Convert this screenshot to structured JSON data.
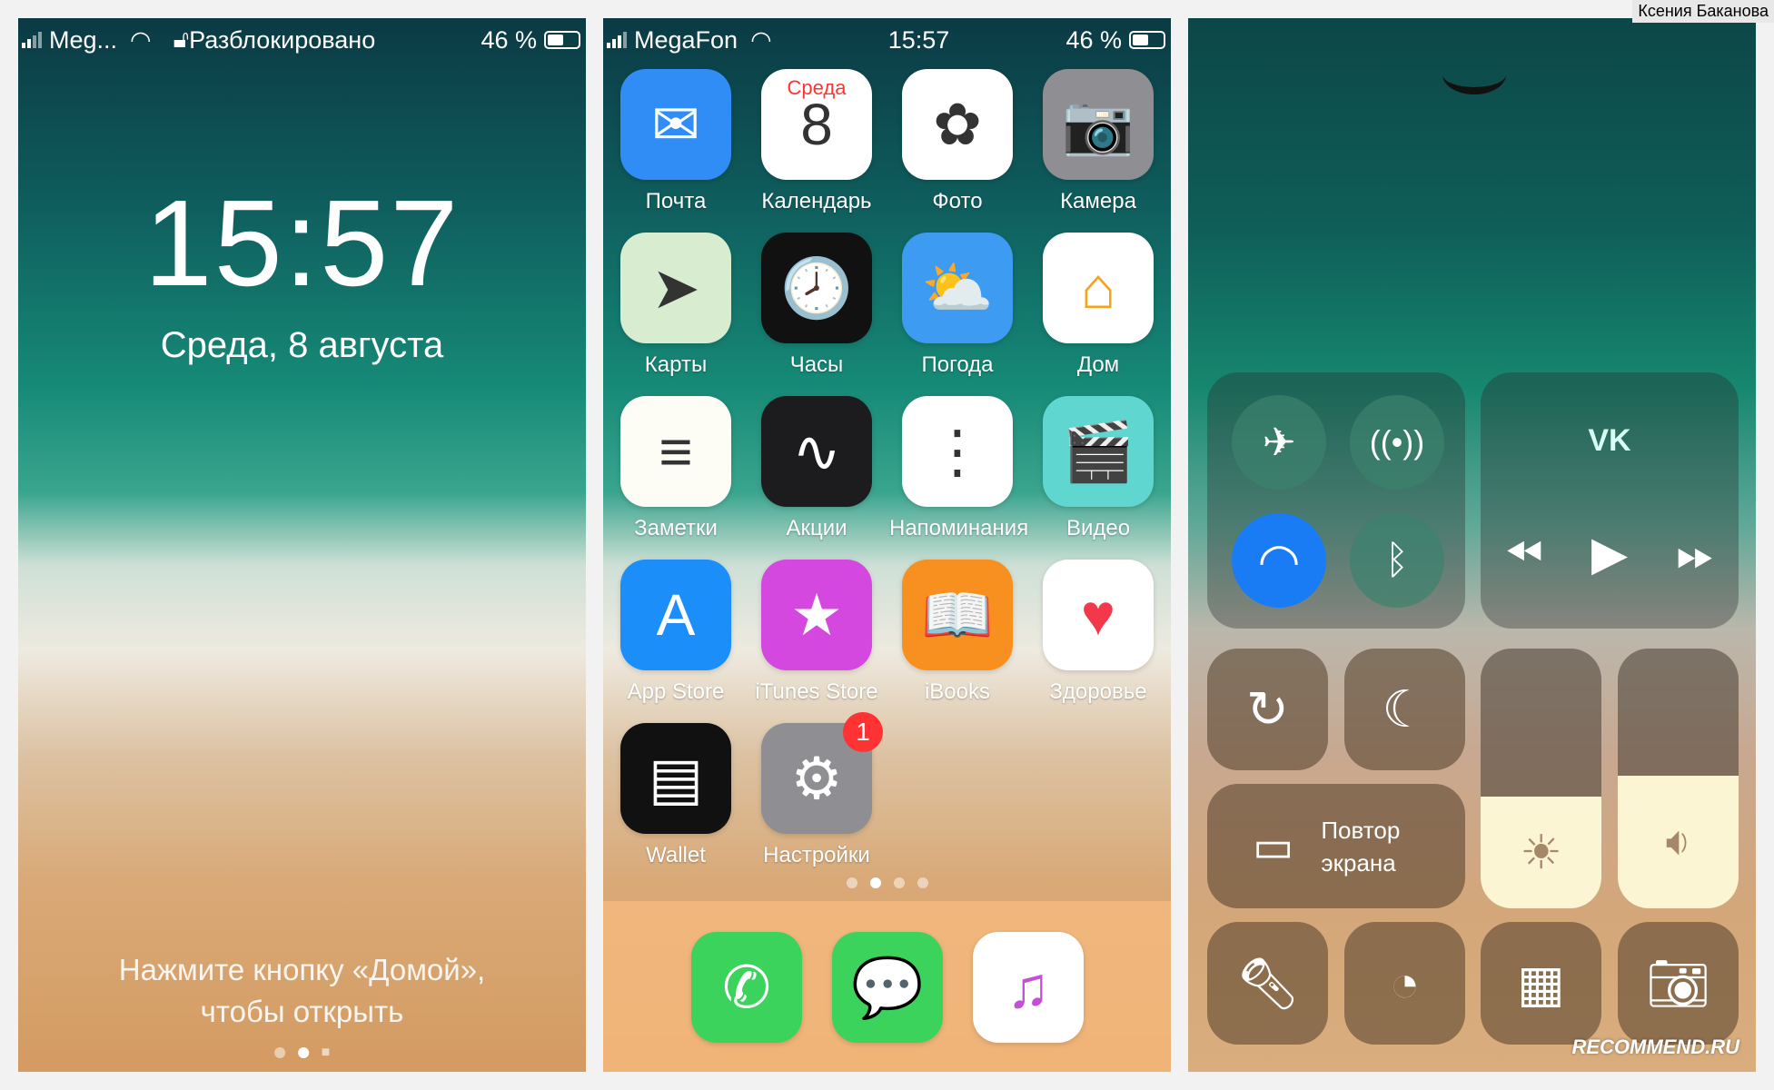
{
  "watermark_author": "Ксения Баканова",
  "watermark_site": "RECOMMEND.RU",
  "lock": {
    "carrier": "Meg...",
    "lock_status": "Разблокировано",
    "battery": "46 %",
    "time": "15:57",
    "date": "Среда, 8 августа",
    "hint_line1": "Нажмите кнопку «Домой»,",
    "hint_line2": "чтобы открыть"
  },
  "home": {
    "carrier": "MegaFon",
    "time": "15:57",
    "battery": "46 %",
    "apps": [
      {
        "label": "Почта",
        "icon": "mail-icon",
        "color": "#2f8df5",
        "glyph": "✉"
      },
      {
        "label": "Календарь",
        "icon": "calendar-icon",
        "color": "#ffffff",
        "glyph": "8",
        "sub": "Среда"
      },
      {
        "label": "Фото",
        "icon": "photos-icon",
        "color": "#ffffff",
        "glyph": "✿"
      },
      {
        "label": "Камера",
        "icon": "camera-icon",
        "color": "#8e8e93",
        "glyph": "📷"
      },
      {
        "label": "Карты",
        "icon": "maps-icon",
        "color": "#d8ecd0",
        "glyph": "➤"
      },
      {
        "label": "Часы",
        "icon": "clock-icon",
        "color": "#111111",
        "glyph": "🕗"
      },
      {
        "label": "Погода",
        "icon": "weather-icon",
        "color": "#3e9bf2",
        "glyph": "⛅"
      },
      {
        "label": "Дом",
        "icon": "home-icon",
        "color": "#ffffff",
        "glyph": "⌂"
      },
      {
        "label": "Заметки",
        "icon": "notes-icon",
        "color": "#fdfdf6",
        "glyph": "≡"
      },
      {
        "label": "Акции",
        "icon": "stocks-icon",
        "color": "#1c1c1e",
        "glyph": "∿"
      },
      {
        "label": "Напоминания",
        "icon": "reminders-icon",
        "color": "#ffffff",
        "glyph": "⋮"
      },
      {
        "label": "Видео",
        "icon": "videos-icon",
        "color": "#5fd6cf",
        "glyph": "🎬"
      },
      {
        "label": "App Store",
        "icon": "app-store-icon",
        "color": "#1c8ef9",
        "glyph": "A"
      },
      {
        "label": "iTunes Store",
        "icon": "itunes-star-icon",
        "color": "#d448e0",
        "glyph": "★"
      },
      {
        "label": "iBooks",
        "icon": "ibooks-icon",
        "color": "#f7901e",
        "glyph": "📖"
      },
      {
        "label": "Здоровье",
        "icon": "health-heart-icon",
        "color": "#ffffff",
        "glyph": "♥"
      },
      {
        "label": "Wallet",
        "icon": "wallet-icon",
        "color": "#111111",
        "glyph": "▤"
      },
      {
        "label": "Настройки",
        "icon": "settings-gear-icon",
        "color": "#8e8e93",
        "glyph": "⚙",
        "badge": "1"
      }
    ],
    "dock": [
      {
        "icon": "phone-icon",
        "color": "#3bd35b",
        "glyph": "✆"
      },
      {
        "icon": "messages-icon",
        "color": "#3bd35b",
        "glyph": "💬"
      },
      {
        "icon": "music-icon",
        "color": "#ffffff",
        "glyph": "♫"
      }
    ]
  },
  "control_center": {
    "media_app": "VK",
    "mirroring_line1": "Повтор",
    "mirroring_line2": "экрана",
    "brightness_percent": 43,
    "volume_percent": 51,
    "wifi_on": true,
    "accent": "#1a7cf5"
  }
}
